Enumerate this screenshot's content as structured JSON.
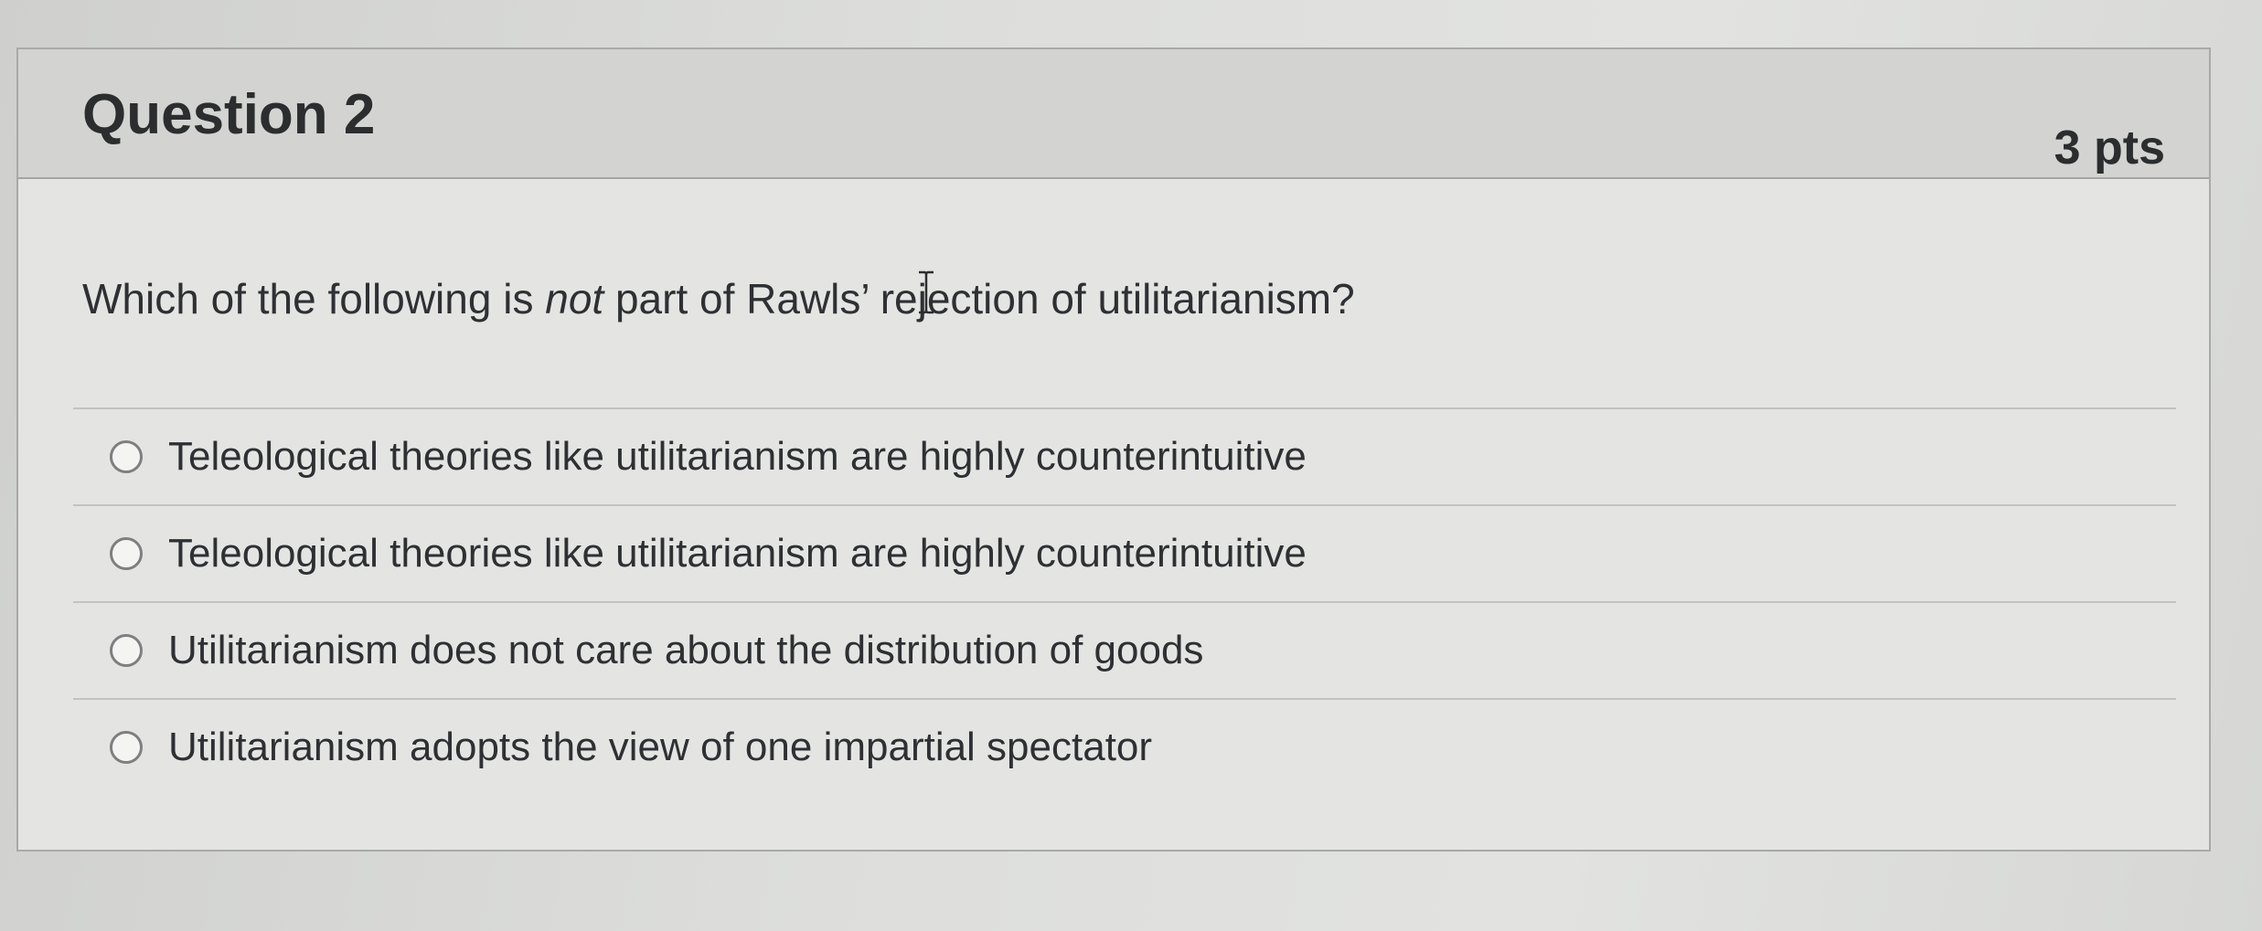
{
  "question": {
    "title": "Question 2",
    "points": "3 pts",
    "text_before": "Which of the following is ",
    "text_emphasis": "not",
    "text_after": " part of Rawls’ rejection of utilitarianism?",
    "answers": [
      {
        "label": "Teleological theories like utilitarianism are highly counterintuitive"
      },
      {
        "label": "Teleological theories like utilitarianism are highly counterintuitive"
      },
      {
        "label": "Utilitarianism does not care about the distribution of goods"
      },
      {
        "label": "Utilitarianism adopts the view of one impartial spectator"
      }
    ]
  },
  "cursor": {
    "icon": "text-cursor-icon"
  }
}
